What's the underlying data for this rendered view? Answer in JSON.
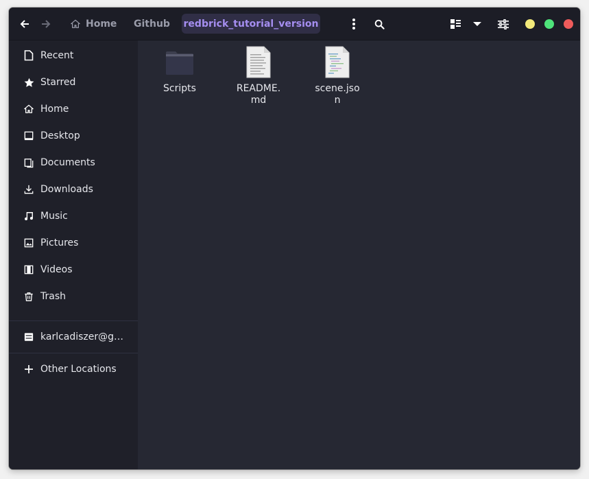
{
  "header": {
    "back_icon": "arrow-left-icon",
    "forward_icon": "arrow-right-icon",
    "breadcrumbs": [
      {
        "label": "Home",
        "icon": "home-icon"
      },
      {
        "label": "Github"
      },
      {
        "label": "redbrick_tutorial_version",
        "active": true
      }
    ],
    "menu_icon": "vertical-dots-icon",
    "search_icon": "search-icon",
    "view_icon": "list-grid-view-icon",
    "view_dropdown_icon": "chevron-down-icon",
    "settings_icon": "sliders-icon",
    "window_controls": [
      {
        "name": "minimize",
        "color": "#f2e97a"
      },
      {
        "name": "maximize",
        "color": "#4ee37a"
      },
      {
        "name": "close",
        "color": "#ee5b5b"
      }
    ]
  },
  "sidebar": {
    "items": [
      {
        "label": "Recent",
        "icon": "recent-document-icon"
      },
      {
        "label": "Starred",
        "icon": "star-icon"
      },
      {
        "label": "Home",
        "icon": "home-icon"
      },
      {
        "label": "Desktop",
        "icon": "desktop-icon"
      },
      {
        "label": "Documents",
        "icon": "documents-icon"
      },
      {
        "label": "Downloads",
        "icon": "download-icon"
      },
      {
        "label": "Music",
        "icon": "music-icon"
      },
      {
        "label": "Pictures",
        "icon": "pictures-icon"
      },
      {
        "label": "Videos",
        "icon": "videos-icon"
      },
      {
        "label": "Trash",
        "icon": "trash-icon"
      }
    ],
    "drives": [
      {
        "label": "karlcadiszer@g…",
        "icon": "network-drive-icon"
      }
    ],
    "other_locations": {
      "label": "Other Locations",
      "icon": "plus-icon"
    }
  },
  "files": [
    {
      "name": "Scripts",
      "type": "folder",
      "icon": "folder-icon"
    },
    {
      "name": "README.md",
      "type": "markdown",
      "icon": "text-document-icon"
    },
    {
      "name": "scene.json",
      "type": "json",
      "icon": "code-document-icon"
    }
  ],
  "colors": {
    "accent": "#a58ef0",
    "window_bg": "#262833",
    "sidebar_bg": "#1f2029",
    "header_bg": "#1c1d26"
  }
}
